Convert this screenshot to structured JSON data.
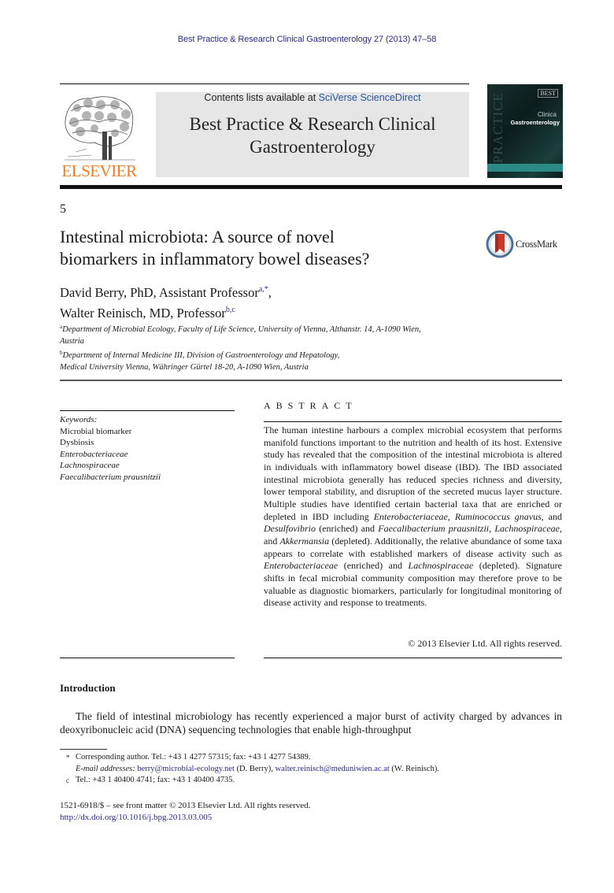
{
  "header": {
    "journal_reference": "Best Practice & Research Clinical Gastroenterology 27 (2013) 47–58",
    "contents_prefix": "Contents lists available at ",
    "contents_link": "SciVerse ScienceDirect",
    "journal_title_line1": "Best Practice & Research Clinical",
    "journal_title_line2": "Gastroenterology",
    "publisher_logo": "ELSEVIER",
    "cover": {
      "badge": "BEST",
      "vertical_text": "PRACTICE",
      "line1": "Clinica",
      "line2": "Gastroenterology"
    },
    "colors": {
      "publisher_orange": "#ef7d22",
      "link_blue": "#2a2a86",
      "masthead_gray": "#e6e6e6",
      "cover_teal": "#2b8a85"
    }
  },
  "article": {
    "number": "5",
    "title_line1": "Intestinal microbiota: A source of novel",
    "title_line2": "biomarkers in inflammatory bowel diseases?",
    "crossmark_label": "CrossMark",
    "authors": [
      {
        "name": "David Berry, PhD, Assistant Professor",
        "sup": "a,*",
        "trail": ","
      },
      {
        "name": "Walter Reinisch, MD, Professor",
        "sup": "b,c",
        "trail": ""
      }
    ],
    "affiliations": [
      {
        "mark": "a",
        "line1": "Department of Microbial Ecology, Faculty of Life Science, University of Vienna, Althanstr. 14, A-1090 Wien,",
        "line2": "Austria"
      },
      {
        "mark": "b",
        "line1": "Department of Internal Medicine III, Division of Gastroenterology and Hepatology,",
        "line2": "Medical University Vienna, Währinger Gürtel 18-20, A-1090 Wien, Austria"
      }
    ]
  },
  "keywords": {
    "heading": "Keywords:",
    "items": [
      {
        "text": "Microbial biomarker",
        "italic": false
      },
      {
        "text": "Dysbiosis",
        "italic": false
      },
      {
        "text": "Enterobacteriaceae",
        "italic": true
      },
      {
        "text": "Lachnospiraceae",
        "italic": true
      },
      {
        "text": "Faecalibacterium prausnitzii",
        "italic": true
      }
    ]
  },
  "abstract": {
    "heading": "ABSTRACT",
    "segments": [
      {
        "t": "The human intestine harbours a complex microbial ecosystem that performs manifold functions important to the nutrition and health of its host. Extensive study has revealed that the composition of the intestinal microbiota is altered in individuals with inflammatory bowel disease (IBD). The IBD associated intestinal microbiota generally has reduced species richness and diversity, lower temporal stability, and disruption of the secreted mucus layer structure. Multiple studies have identified certain bacterial taxa that are enriched or depleted in IBD including ",
        "i": false
      },
      {
        "t": "Enterobacteriaceae",
        "i": true
      },
      {
        "t": ", ",
        "i": false
      },
      {
        "t": "Ruminococcus gnavus",
        "i": true
      },
      {
        "t": ", and ",
        "i": false
      },
      {
        "t": "Desulfovibrio",
        "i": true
      },
      {
        "t": " (enriched) and ",
        "i": false
      },
      {
        "t": "Faecalibacterium prausnitzii",
        "i": true
      },
      {
        "t": ", ",
        "i": false
      },
      {
        "t": "Lachnospiraceae",
        "i": true
      },
      {
        "t": ", and ",
        "i": false
      },
      {
        "t": "Akkermansia",
        "i": true
      },
      {
        "t": " (depleted). Additionally, the relative abundance of some taxa appears to correlate with established markers of disease activity such as ",
        "i": false
      },
      {
        "t": "Enterobacteriaceae",
        "i": true
      },
      {
        "t": " (enriched) and ",
        "i": false
      },
      {
        "t": "Lachnospiraceae",
        "i": true
      },
      {
        "t": " (depleted). Signature shifts in fecal microbial community composition may therefore prove to be valuable as diagnostic biomarkers, particularly for longitudinal monitoring of disease activity and response to treatments.",
        "i": false
      }
    ],
    "copyright": "© 2013 Elsevier Ltd. All rights reserved."
  },
  "introduction": {
    "heading": "Introduction",
    "text": "The field of intestinal microbiology has recently experienced a major burst of activity charged by advances in deoxyribonucleic acid (DNA) sequencing technologies that enable high-throughput"
  },
  "footnotes": {
    "corresponding_mark": "*",
    "corresponding": "Corresponding author. Tel.: +43 1 4277 57315; fax: +43 1 4277 54389.",
    "email_label": "E-mail addresses:",
    "email1": "berry@microbial-ecology.net",
    "email1_who": " (D. Berry), ",
    "email2": "walter.reinisch@meduniwien.ac.at",
    "email2_who": " (W. Reinisch).",
    "c_mark": "c",
    "c_text": "Tel.: +43 1 40400 4741; fax: +43 1 40400 4735."
  },
  "front_matter": {
    "issn_line": "1521-6918/$ – see front matter © 2013 Elsevier Ltd. All rights reserved.",
    "doi": "http://dx.doi.org/10.1016/j.bpg.2013.03.005"
  }
}
